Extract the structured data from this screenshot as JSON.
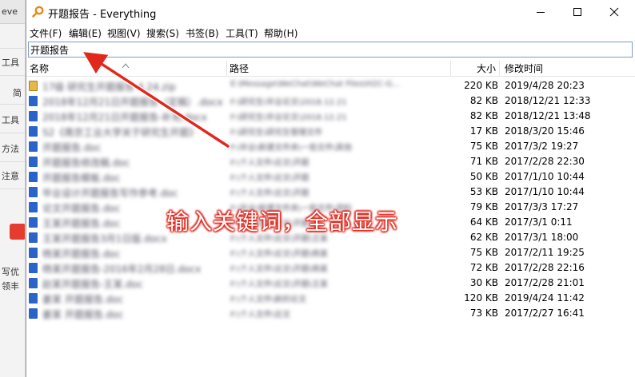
{
  "background_window": {
    "tab_text": "eve",
    "items": [
      "工具",
      "简",
      "工具",
      "方法",
      "注意",
      "写优",
      "领丰"
    ]
  },
  "window": {
    "title": "开题报告 - Everything",
    "controls": {
      "minimize": "—",
      "maximize": "☐",
      "close": "✕"
    }
  },
  "menu": [
    "文件(F)",
    "编辑(E)",
    "视图(V)",
    "搜索(S)",
    "书签(B)",
    "工具(T)",
    "帮助(H)"
  ],
  "search": {
    "value": "开题报告"
  },
  "columns": {
    "name": "名称",
    "path": "路径",
    "size": "大小",
    "modified": "修改时间"
  },
  "rows": [
    {
      "name": "17级 研究生开题报告 4.24.zip",
      "path": "E:\\Message\\WeChat\\WeChat Files\\H2C-G...",
      "size": "220 KB",
      "modified": "2019/4/28 20:23",
      "icon": "zip-file-icon"
    },
    {
      "name": "2018年12月21日开题报告（定稿）.docx",
      "path": "F:\\研究生\\毕业论文\\2018.12.21",
      "size": "82 KB",
      "modified": "2018/12/21 12:33",
      "icon": "word-file-icon"
    },
    {
      "name": "2018年12月21日开题报告-补充.docx",
      "path": "F:\\研究生\\毕业论文\\2018.12.21",
      "size": "82 KB",
      "modified": "2018/12/21 13:48",
      "icon": "word-file-icon"
    },
    {
      "name": "S2《南京工业大学关于研究生开题》",
      "path": "F:\\研究生\\研究生管理文件",
      "size": "17 KB",
      "modified": "2018/3/20 15:46",
      "icon": "word-file-icon"
    },
    {
      "name": "开题报告.doc",
      "path": "F:\\毕业\\新建文件夹\\一些文件\\其他",
      "size": "75 KB",
      "modified": "2017/3/2 19:27",
      "icon": "word-file-icon"
    },
    {
      "name": "开题报告修改稿.doc",
      "path": "F:\\个人文件\\论文\\开题",
      "size": "71 KB",
      "modified": "2017/2/28 22:30",
      "icon": "word-file-icon"
    },
    {
      "name": "开题报告模板.doc",
      "path": "F:\\个人文件\\论文\\开题",
      "size": "50 KB",
      "modified": "2017/1/10 10:44",
      "icon": "word-file-icon"
    },
    {
      "name": "毕业设计开题报告写作参考.doc",
      "path": "F:\\个人文件\\论文\\开题",
      "size": "53 KB",
      "modified": "2017/1/10 10:44",
      "icon": "word-file-icon"
    },
    {
      "name": "论文开题报告.doc",
      "path": "F:\\毕业\\新建文件夹\\一些文件\\资料",
      "size": "79 KB",
      "modified": "2017/3/3 17:27",
      "icon": "word-file-icon"
    },
    {
      "name": "王某开题报告.doc",
      "path": "F:\\个人文件\\论文\\开题",
      "size": "64 KB",
      "modified": "2017/3/1 0:11",
      "icon": "word-file-icon"
    },
    {
      "name": "王某开题报告3月1日版.docx",
      "path": "F:\\个人文件\\论文\\开题\\王某",
      "size": "62 KB",
      "modified": "2017/3/1 18:00",
      "icon": "word-file-icon"
    },
    {
      "name": "杨某开题报告.doc",
      "path": "F:\\个人文件\\论文\\开题\\杨某",
      "size": "75 KB",
      "modified": "2017/2/11 19:25",
      "icon": "word-file-icon"
    },
    {
      "name": "杨某开题报告-2016年2月28日.docx",
      "path": "F:\\个人文件\\论文\\开题\\杨某",
      "size": "72 KB",
      "modified": "2017/2/28 22:16",
      "icon": "word-file-icon"
    },
    {
      "name": "赵某开题报告-王某.doc",
      "path": "F:\\个人文件\\论文\\开题\\王某",
      "size": "30 KB",
      "modified": "2017/2/28 21:01",
      "icon": "word-file-icon"
    },
    {
      "name": "姜某 开题报告.doc",
      "path": "F:\\个人文件\\新的论文",
      "size": "120 KB",
      "modified": "2019/4/24 11:42",
      "icon": "word-file-icon"
    },
    {
      "name": "姜某 开题报告.doc",
      "path": "F:\\个人文件\\论文",
      "size": "73 KB",
      "modified": "2017/2/27 16:41",
      "icon": "word-file-icon"
    }
  ],
  "annotation": {
    "text": "输入关键词，全部显示",
    "color": "#e0281d"
  },
  "colors": {
    "selection_border": "#7a9cd3",
    "arrow": "#e0281d",
    "app_icon": "#e88a1a"
  }
}
